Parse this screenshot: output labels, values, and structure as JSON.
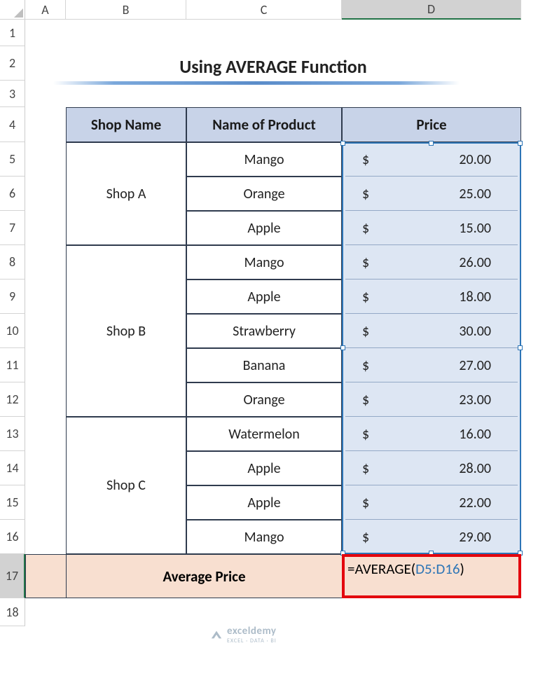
{
  "columns": [
    "A",
    "B",
    "C",
    "D"
  ],
  "rows": [
    "1",
    "2",
    "3",
    "4",
    "5",
    "6",
    "7",
    "8",
    "9",
    "10",
    "11",
    "12",
    "13",
    "14",
    "15",
    "16",
    "17",
    "18"
  ],
  "title": "Using AVERAGE Function",
  "headers": {
    "shop": "Shop Name",
    "product": "Name of Product",
    "price": "Price"
  },
  "rowsData": [
    {
      "shop": "Shop A",
      "product": "Mango",
      "currency": "$",
      "price": "20.00"
    },
    {
      "shop": "",
      "product": "Orange",
      "currency": "$",
      "price": "25.00"
    },
    {
      "shop": "",
      "product": "Apple",
      "currency": "$",
      "price": "15.00"
    },
    {
      "shop": "Shop B",
      "product": "Mango",
      "currency": "$",
      "price": "26.00"
    },
    {
      "shop": "",
      "product": "Apple",
      "currency": "$",
      "price": "18.00"
    },
    {
      "shop": "",
      "product": "Strawberry",
      "currency": "$",
      "price": "30.00"
    },
    {
      "shop": "",
      "product": "Banana",
      "currency": "$",
      "price": "27.00"
    },
    {
      "shop": "",
      "product": "Orange",
      "currency": "$",
      "price": "23.00"
    },
    {
      "shop": "Shop C",
      "product": "Watermelon",
      "currency": "$",
      "price": "16.00"
    },
    {
      "shop": "",
      "product": "Apple",
      "currency": "$",
      "price": "28.00"
    },
    {
      "shop": "",
      "product": "Apple",
      "currency": "$",
      "price": "22.00"
    },
    {
      "shop": "",
      "product": "Mango",
      "currency": "$",
      "price": "29.00"
    }
  ],
  "avgLabel": "Average Price",
  "formula": {
    "prefix": "=AVERAGE(",
    "ref": "D5:D16",
    "suffix": ")"
  },
  "activeColumn": "D",
  "activeRow": "17",
  "watermark": {
    "name": "exceldemy",
    "tagline": "EXCEL · DATA · BI"
  }
}
